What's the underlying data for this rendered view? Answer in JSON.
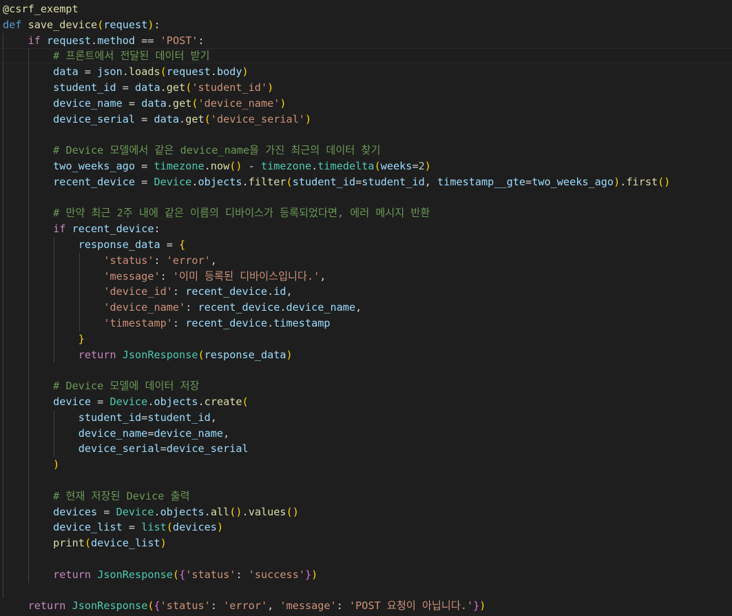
{
  "editor": {
    "language": "python",
    "theme_colors": {
      "background": "#1e1e1e",
      "keyword": "#569cd6",
      "control": "#c586c0",
      "function": "#dcdcaa",
      "variable": "#9cdcfe",
      "class": "#4ec9b0",
      "string": "#ce9178",
      "number": "#b5cea8",
      "comment": "#6a9955",
      "bracket_level_1": "#ffd700",
      "bracket_level_2": "#da70d6",
      "bracket_level_3": "#179fff"
    },
    "lines": [
      [
        [
          "deco",
          "@csrf_exempt"
        ]
      ],
      [
        [
          "keyword",
          "def"
        ],
        [
          "plain",
          " "
        ],
        [
          "func",
          "save_device"
        ],
        [
          "br1",
          "("
        ],
        [
          "param",
          "request"
        ],
        [
          "br1",
          ")"
        ],
        [
          "plain",
          ":"
        ]
      ],
      [
        [
          "plain",
          "    "
        ],
        [
          "control",
          "if"
        ],
        [
          "plain",
          " "
        ],
        [
          "var",
          "request"
        ],
        [
          "plain",
          "."
        ],
        [
          "var",
          "method"
        ],
        [
          "plain",
          " == "
        ],
        [
          "str",
          "'POST'"
        ],
        [
          "plain",
          ":"
        ]
      ],
      [
        [
          "plain",
          "        "
        ],
        [
          "comment",
          "# 프론트에서 전달된 데이터 받기"
        ]
      ],
      [
        [
          "plain",
          "        "
        ],
        [
          "var",
          "data"
        ],
        [
          "plain",
          " = "
        ],
        [
          "var",
          "json"
        ],
        [
          "plain",
          "."
        ],
        [
          "func",
          "loads"
        ],
        [
          "br1",
          "("
        ],
        [
          "var",
          "request"
        ],
        [
          "plain",
          "."
        ],
        [
          "var",
          "body"
        ],
        [
          "br1",
          ")"
        ]
      ],
      [
        [
          "plain",
          "        "
        ],
        [
          "var",
          "student_id"
        ],
        [
          "plain",
          " = "
        ],
        [
          "var",
          "data"
        ],
        [
          "plain",
          "."
        ],
        [
          "func",
          "get"
        ],
        [
          "br1",
          "("
        ],
        [
          "str",
          "'student_id'"
        ],
        [
          "br1",
          ")"
        ]
      ],
      [
        [
          "plain",
          "        "
        ],
        [
          "var",
          "device_name"
        ],
        [
          "plain",
          " = "
        ],
        [
          "var",
          "data"
        ],
        [
          "plain",
          "."
        ],
        [
          "func",
          "get"
        ],
        [
          "br1",
          "("
        ],
        [
          "str",
          "'device_name'"
        ],
        [
          "br1",
          ")"
        ]
      ],
      [
        [
          "plain",
          "        "
        ],
        [
          "var",
          "device_serial"
        ],
        [
          "plain",
          " = "
        ],
        [
          "var",
          "data"
        ],
        [
          "plain",
          "."
        ],
        [
          "func",
          "get"
        ],
        [
          "br1",
          "("
        ],
        [
          "str",
          "'device_serial'"
        ],
        [
          "br1",
          ")"
        ]
      ],
      [],
      [
        [
          "plain",
          "        "
        ],
        [
          "comment",
          "# Device 모델에서 같은 device_name을 가진 최근의 데이터 찾기"
        ]
      ],
      [
        [
          "plain",
          "        "
        ],
        [
          "var",
          "two_weeks_ago"
        ],
        [
          "plain",
          " = "
        ],
        [
          "class",
          "timezone"
        ],
        [
          "plain",
          "."
        ],
        [
          "func",
          "now"
        ],
        [
          "br1",
          "()"
        ],
        [
          "plain",
          " - "
        ],
        [
          "class",
          "timezone"
        ],
        [
          "plain",
          "."
        ],
        [
          "class",
          "timedelta"
        ],
        [
          "br1",
          "("
        ],
        [
          "param",
          "weeks"
        ],
        [
          "plain",
          "="
        ],
        [
          "num",
          "2"
        ],
        [
          "br1",
          ")"
        ]
      ],
      [
        [
          "plain",
          "        "
        ],
        [
          "var",
          "recent_device"
        ],
        [
          "plain",
          " = "
        ],
        [
          "class",
          "Device"
        ],
        [
          "plain",
          "."
        ],
        [
          "var",
          "objects"
        ],
        [
          "plain",
          "."
        ],
        [
          "func",
          "filter"
        ],
        [
          "br1",
          "("
        ],
        [
          "param",
          "student_id"
        ],
        [
          "plain",
          "="
        ],
        [
          "var",
          "student_id"
        ],
        [
          "plain",
          ", "
        ],
        [
          "param",
          "timestamp__gte"
        ],
        [
          "plain",
          "="
        ],
        [
          "var",
          "two_weeks_ago"
        ],
        [
          "br1",
          ")"
        ],
        [
          "plain",
          "."
        ],
        [
          "func",
          "first"
        ],
        [
          "br1",
          "()"
        ]
      ],
      [],
      [
        [
          "plain",
          "        "
        ],
        [
          "comment",
          "# 만약 최근 2주 내에 같은 이름의 디바이스가 등록되었다면, 에러 메시지 반환"
        ]
      ],
      [
        [
          "plain",
          "        "
        ],
        [
          "control",
          "if"
        ],
        [
          "plain",
          " "
        ],
        [
          "var",
          "recent_device"
        ],
        [
          "plain",
          ":"
        ]
      ],
      [
        [
          "plain",
          "            "
        ],
        [
          "var",
          "response_data"
        ],
        [
          "plain",
          " = "
        ],
        [
          "br1",
          "{"
        ]
      ],
      [
        [
          "plain",
          "                "
        ],
        [
          "str",
          "'status'"
        ],
        [
          "plain",
          ": "
        ],
        [
          "str",
          "'error'"
        ],
        [
          "plain",
          ","
        ]
      ],
      [
        [
          "plain",
          "                "
        ],
        [
          "str",
          "'message'"
        ],
        [
          "plain",
          ": "
        ],
        [
          "str",
          "'이미 등록된 디바이스입니다.'"
        ],
        [
          "plain",
          ","
        ]
      ],
      [
        [
          "plain",
          "                "
        ],
        [
          "str",
          "'device_id'"
        ],
        [
          "plain",
          ": "
        ],
        [
          "var",
          "recent_device"
        ],
        [
          "plain",
          "."
        ],
        [
          "var",
          "id"
        ],
        [
          "plain",
          ","
        ]
      ],
      [
        [
          "plain",
          "                "
        ],
        [
          "str",
          "'device_name'"
        ],
        [
          "plain",
          ": "
        ],
        [
          "var",
          "recent_device"
        ],
        [
          "plain",
          "."
        ],
        [
          "var",
          "device_name"
        ],
        [
          "plain",
          ","
        ]
      ],
      [
        [
          "plain",
          "                "
        ],
        [
          "str",
          "'timestamp'"
        ],
        [
          "plain",
          ": "
        ],
        [
          "var",
          "recent_device"
        ],
        [
          "plain",
          "."
        ],
        [
          "var",
          "timestamp"
        ]
      ],
      [
        [
          "plain",
          "            "
        ],
        [
          "br1",
          "}"
        ]
      ],
      [
        [
          "plain",
          "            "
        ],
        [
          "control",
          "return"
        ],
        [
          "plain",
          " "
        ],
        [
          "class",
          "JsonResponse"
        ],
        [
          "br1",
          "("
        ],
        [
          "var",
          "response_data"
        ],
        [
          "br1",
          ")"
        ]
      ],
      [],
      [
        [
          "plain",
          "        "
        ],
        [
          "comment",
          "# Device 모델에 데이터 저장"
        ]
      ],
      [
        [
          "plain",
          "        "
        ],
        [
          "var",
          "device"
        ],
        [
          "plain",
          " = "
        ],
        [
          "class",
          "Device"
        ],
        [
          "plain",
          "."
        ],
        [
          "var",
          "objects"
        ],
        [
          "plain",
          "."
        ],
        [
          "func",
          "create"
        ],
        [
          "br1",
          "("
        ]
      ],
      [
        [
          "plain",
          "            "
        ],
        [
          "param",
          "student_id"
        ],
        [
          "plain",
          "="
        ],
        [
          "var",
          "student_id"
        ],
        [
          "plain",
          ","
        ]
      ],
      [
        [
          "plain",
          "            "
        ],
        [
          "param",
          "device_name"
        ],
        [
          "plain",
          "="
        ],
        [
          "var",
          "device_name"
        ],
        [
          "plain",
          ","
        ]
      ],
      [
        [
          "plain",
          "            "
        ],
        [
          "param",
          "device_serial"
        ],
        [
          "plain",
          "="
        ],
        [
          "var",
          "device_serial"
        ]
      ],
      [
        [
          "plain",
          "        "
        ],
        [
          "br1",
          ")"
        ]
      ],
      [],
      [
        [
          "plain",
          "        "
        ],
        [
          "comment",
          "# 현재 저장된 Device 출력"
        ]
      ],
      [
        [
          "plain",
          "        "
        ],
        [
          "var",
          "devices"
        ],
        [
          "plain",
          " = "
        ],
        [
          "class",
          "Device"
        ],
        [
          "plain",
          "."
        ],
        [
          "var",
          "objects"
        ],
        [
          "plain",
          "."
        ],
        [
          "func",
          "all"
        ],
        [
          "br1",
          "()"
        ],
        [
          "plain",
          "."
        ],
        [
          "func",
          "values"
        ],
        [
          "br1",
          "()"
        ]
      ],
      [
        [
          "plain",
          "        "
        ],
        [
          "var",
          "device_list"
        ],
        [
          "plain",
          " = "
        ],
        [
          "class",
          "list"
        ],
        [
          "br1",
          "("
        ],
        [
          "var",
          "devices"
        ],
        [
          "br1",
          ")"
        ]
      ],
      [
        [
          "plain",
          "        "
        ],
        [
          "func",
          "print"
        ],
        [
          "br1",
          "("
        ],
        [
          "var",
          "device_list"
        ],
        [
          "br1",
          ")"
        ]
      ],
      [],
      [
        [
          "plain",
          "        "
        ],
        [
          "control",
          "return"
        ],
        [
          "plain",
          " "
        ],
        [
          "class",
          "JsonResponse"
        ],
        [
          "br1",
          "("
        ],
        [
          "br2",
          "{"
        ],
        [
          "str",
          "'status'"
        ],
        [
          "plain",
          ": "
        ],
        [
          "str",
          "'success'"
        ],
        [
          "br2",
          "}"
        ],
        [
          "br1",
          ")"
        ]
      ],
      [],
      [
        [
          "plain",
          "    "
        ],
        [
          "control",
          "return"
        ],
        [
          "plain",
          " "
        ],
        [
          "class",
          "JsonResponse"
        ],
        [
          "br1",
          "("
        ],
        [
          "br2",
          "{"
        ],
        [
          "str",
          "'status'"
        ],
        [
          "plain",
          ": "
        ],
        [
          "str",
          "'error'"
        ],
        [
          "plain",
          ", "
        ],
        [
          "str",
          "'message'"
        ],
        [
          "plain",
          ": "
        ],
        [
          "str",
          "'POST 요청이 아닙니다.'"
        ],
        [
          "br2",
          "}"
        ],
        [
          "br1",
          ")"
        ]
      ]
    ]
  }
}
